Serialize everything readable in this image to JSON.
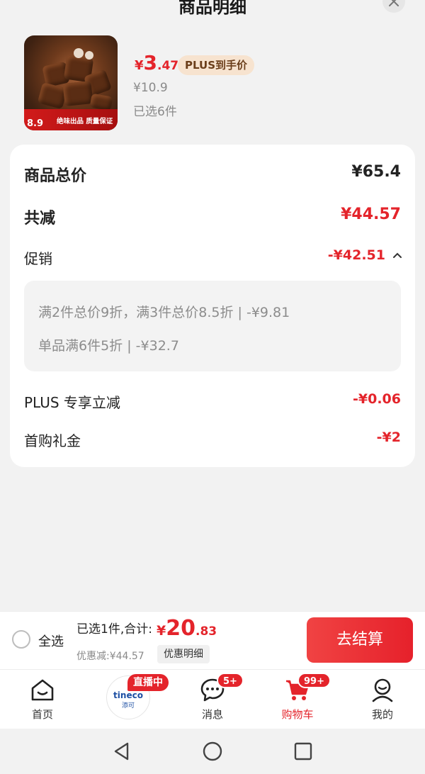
{
  "header": {
    "title": "商品明细"
  },
  "product": {
    "thumb_price": "8.9",
    "thumb_promo": "绝味出品 质量保证",
    "price_symbol": "¥",
    "price_int": "3",
    "price_dec": ".47",
    "plus_badge": "PLUS到手价",
    "original_price": "¥10.9",
    "selected_count": "已选6件"
  },
  "summary": {
    "total_label": "商品总价",
    "total_value": "¥65.4",
    "reduce_label": "共减",
    "reduce_value": "¥44.57",
    "promo_label": "促销",
    "promo_value": "-¥42.51",
    "promo_lines": [
      "满2件总价9折，满3件总价8.5折 | -¥9.81",
      "单品满6件5折 | -¥32.7"
    ],
    "plus_label": "PLUS 专享立减",
    "plus_value": "-¥0.06",
    "gift_label": "首购礼金",
    "gift_value": "-¥2"
  },
  "checkout": {
    "select_all": "全选",
    "selected_text": "已选1件,合计:",
    "sum_symbol": "¥",
    "sum_int": "20",
    "sum_dec": ".83",
    "discount_text": "优惠减:¥44.57",
    "discount_detail_button": "优惠明细",
    "pay_button": "去结算"
  },
  "tabbar": {
    "home": "首页",
    "live_badge": "直播中",
    "live_brand": "tineco",
    "live_brand_cn": "添可",
    "messages": "消息",
    "messages_badge": "5+",
    "cart": "购物车",
    "cart_badge": "99+",
    "me": "我的"
  },
  "colors": {
    "accent": "#e4242b",
    "plus_badge_bg": "#f7e3cf"
  },
  "icons": [
    "close-icon",
    "chevron-up-icon",
    "home-icon",
    "message-icon",
    "cart-icon",
    "user-icon",
    "back-icon",
    "home-circle-icon",
    "recents-icon"
  ]
}
